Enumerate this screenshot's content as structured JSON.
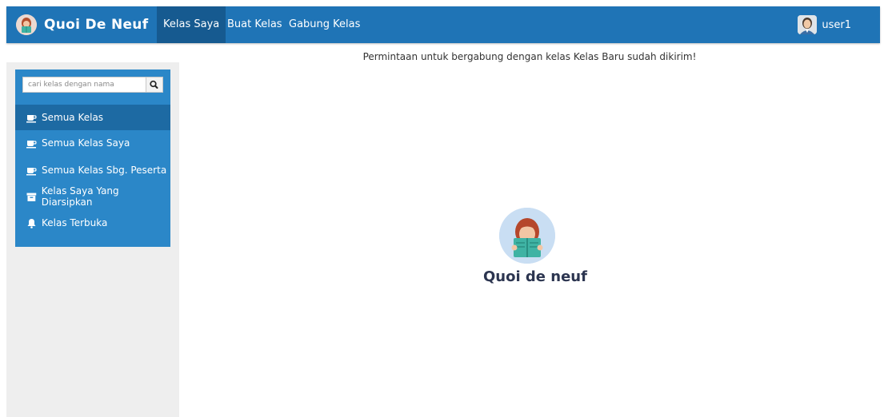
{
  "header": {
    "brand": "Quoi De Neuf",
    "nav": [
      "Kelas Saya",
      "Buat Kelas",
      "Gabung Kelas"
    ],
    "active_nav": "Kelas Saya",
    "user": "user1",
    "bar_color": "#1f74b6"
  },
  "sidebar": {
    "search": {
      "placeholder": "cari kelas dengan nama",
      "value": "",
      "icon": "search-icon"
    },
    "items": [
      {
        "label": "Semua Kelas",
        "icon": "coffee-cup-icon",
        "active": true
      },
      {
        "label": "Semua Kelas Saya",
        "icon": "coffee-cup-icon"
      },
      {
        "label": "Semua Kelas Sbg. Peserta",
        "icon": "coffee-cup-icon"
      },
      {
        "label": "Kelas Saya Yang Diarsipkan",
        "icon": "archive-box-icon"
      },
      {
        "label": "Kelas Terbuka",
        "icon": "bell-icon"
      }
    ],
    "color": "#2b87c8"
  },
  "main": {
    "message": "Permintaan untuk bergabung dengan kelas Kelas Baru sudah dikirim!",
    "hero_title": "Quoi de neuf"
  }
}
